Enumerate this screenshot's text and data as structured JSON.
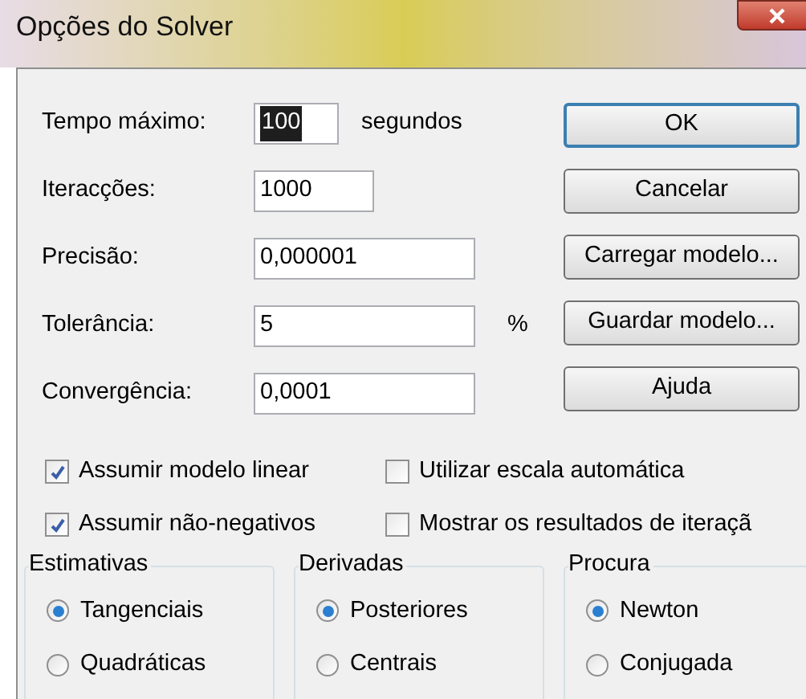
{
  "window": {
    "title": "Opções do Solver"
  },
  "fields": [
    {
      "label": "Tempo máximo:",
      "value": "100",
      "unit": "segundos",
      "selected": true
    },
    {
      "label": "Iteracções:",
      "value": "1000",
      "selected": false
    },
    {
      "label": "Precisão:",
      "value": "0,000001",
      "selected": false
    },
    {
      "label": "Tolerância:",
      "value": "5",
      "unit": "%",
      "selected": false
    },
    {
      "label": "Convergência:",
      "value": "0,0001",
      "selected": false
    }
  ],
  "buttons": [
    {
      "label": "OK",
      "default": true
    },
    {
      "label": "Cancelar",
      "default": false
    },
    {
      "label": "Carregar modelo...",
      "default": false
    },
    {
      "label": "Guardar modelo...",
      "default": false
    },
    {
      "label": "Ajuda",
      "default": false
    }
  ],
  "checkboxes": [
    {
      "label": "Assumir modelo linear",
      "checked": true
    },
    {
      "label": "Utilizar escala automática",
      "checked": false
    },
    {
      "label": "Assumir não-negativos",
      "checked": true
    },
    {
      "label": "Mostrar os resultados de iteraçã",
      "checked": false
    }
  ],
  "groups": [
    {
      "title": "Estimativas",
      "options": [
        {
          "label": "Tangenciais",
          "selected": true
        },
        {
          "label": "Quadráticas",
          "selected": false
        }
      ]
    },
    {
      "title": "Derivadas",
      "options": [
        {
          "label": "Posteriores",
          "selected": true
        },
        {
          "label": "Centrais",
          "selected": false
        }
      ]
    },
    {
      "title": "Procura",
      "options": [
        {
          "label": "Newton",
          "selected": true
        },
        {
          "label": "Conjugada",
          "selected": false
        }
      ]
    }
  ]
}
